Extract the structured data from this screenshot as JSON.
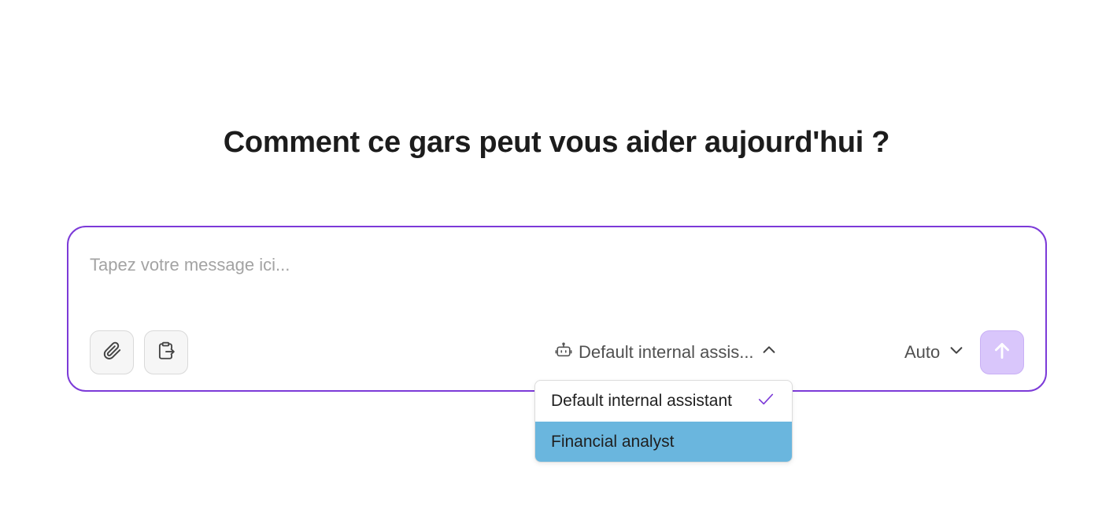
{
  "heading": "Comment ce gars peut vous aider aujourd'hui ?",
  "composer": {
    "placeholder": "Tapez votre message ici...",
    "message_value": "",
    "attach_icon": "paperclip-icon",
    "clipboard_icon": "clipboard-paste-icon",
    "assistant_selector": {
      "icon": "robot-icon",
      "label": "Default internal assis...",
      "chevron": "chevron-up-icon"
    },
    "mode_selector": {
      "label": "Auto",
      "chevron": "chevron-down-icon"
    },
    "send_icon": "arrow-up-icon"
  },
  "assistant_dropdown": {
    "options": [
      {
        "label": "Default internal assistant",
        "selected": true
      },
      {
        "label": "Financial analyst",
        "selected": false,
        "highlighted": true
      }
    ]
  },
  "colors": {
    "accent_border": "#7c3ad8",
    "check_mark": "#7c3ad8",
    "send_button_bg": "#d9c6fb",
    "highlight_bg": "#6ab6de"
  }
}
